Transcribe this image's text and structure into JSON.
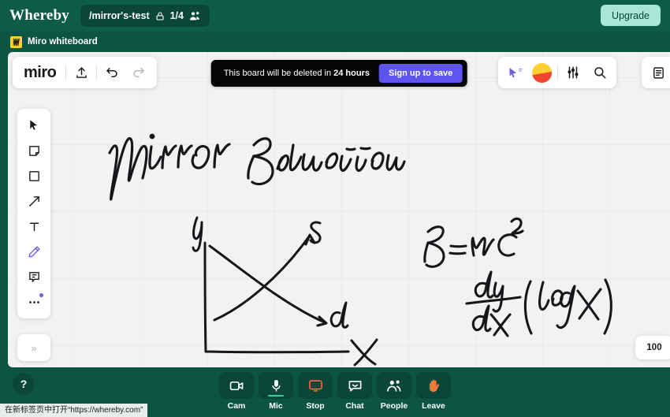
{
  "header": {
    "brand": "Whereby",
    "room": {
      "name": "/mirror's-test",
      "lock_icon": "lock-icon",
      "participants": "1/4",
      "people_icon": "people-icon"
    },
    "upgrade_label": "Upgrade"
  },
  "tab_strip": {
    "miro_badge": "M",
    "label": "Miro whiteboard"
  },
  "miro": {
    "logo": "miro",
    "toolbar": {
      "upload_icon": "upload-icon",
      "undo_icon": "undo-icon",
      "redo_icon": "redo-icon"
    },
    "banner": {
      "text_before": "This board will be deleted in ",
      "text_bold": "24 hours",
      "button_label": "Sign up to save"
    },
    "right_toolbar": {
      "cursor_icon": "cursor-pointer-icon",
      "avatar": "user-avatar",
      "settings_icon": "sliders-icon",
      "search_icon": "search-icon",
      "notes_icon": "notes-list-icon"
    },
    "tools": [
      {
        "name": "select-tool",
        "icon": "cursor-arrow-icon",
        "active": false
      },
      {
        "name": "sticky-note-tool",
        "icon": "sticky-note-icon",
        "active": false
      },
      {
        "name": "shape-tool",
        "icon": "square-icon",
        "active": false
      },
      {
        "name": "arrow-tool",
        "icon": "arrow-icon",
        "active": false
      },
      {
        "name": "text-tool",
        "icon": "text-t-icon",
        "active": false
      },
      {
        "name": "pen-tool",
        "icon": "pencil-icon",
        "active": true
      },
      {
        "name": "comment-tool",
        "icon": "comment-icon",
        "active": false
      },
      {
        "name": "more-tool",
        "icon": "ellipsis-icon",
        "active": false
      }
    ],
    "expand_label": "»",
    "zoom_level": "100"
  },
  "canvas_ink": {
    "title": "Mirror Education",
    "chart": {
      "y_axis_label": "y",
      "x_axis_label": "x",
      "supply_label": "s",
      "demand_label": "d"
    },
    "equation": "E = mc²",
    "derivative": "dy/dx (log x)"
  },
  "controls": [
    {
      "label": "Cam",
      "icon": "camera-icon",
      "active": false,
      "accent": "#ffffff"
    },
    {
      "label": "Mic",
      "icon": "mic-icon",
      "active": true,
      "accent": "#ffffff"
    },
    {
      "label": "Stop",
      "icon": "monitor-icon",
      "active": false,
      "accent": "#f0653a"
    },
    {
      "label": "Chat",
      "icon": "chat-icon",
      "active": false,
      "accent": "#ffffff"
    },
    {
      "label": "People",
      "icon": "people-icon",
      "active": false,
      "accent": "#ffffff"
    },
    {
      "label": "Leave",
      "icon": "hand-icon",
      "active": false,
      "accent": "#f07a3a"
    }
  ],
  "help_label": "?",
  "statusbar_text": "在新标签页中打开“https://whereby.com”",
  "colors": {
    "app_bg": "#0d5543",
    "header_bg": "#0d5c48",
    "pill_bg": "#0a4738",
    "upgrade_bg": "#a8e6d5",
    "banner_bg": "#050505",
    "banner_btn": "#5e54f0",
    "board_bg": "#f2f2f3",
    "active_tool": "#6b5ce7",
    "mic_active": "#31d0a0"
  }
}
